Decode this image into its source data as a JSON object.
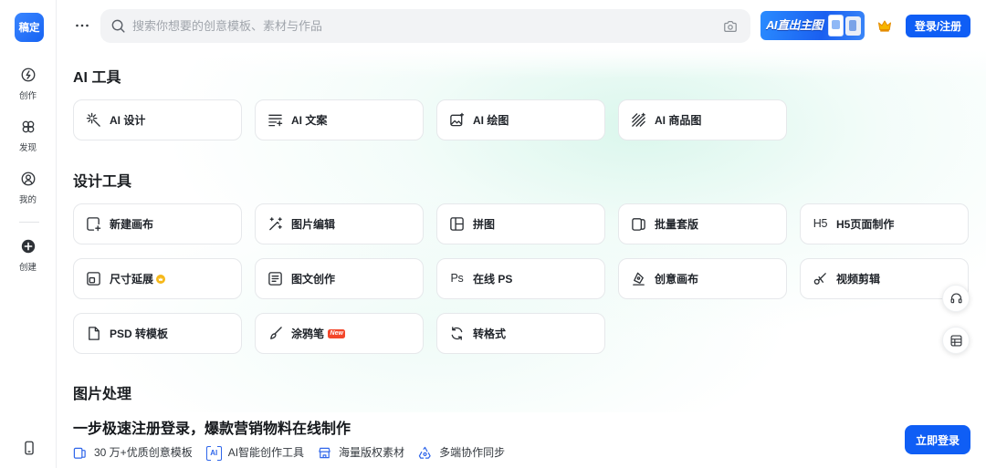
{
  "colors": {
    "primary": "#0f5ef5",
    "logo": "#1763f3",
    "new_badge": "#f3472b",
    "vip_badge": "#f6b81a",
    "feature_icon": "#2f66ea",
    "background_tint": "#e4f9f2"
  },
  "brand": {
    "logo_text": "稿定"
  },
  "sidebar": {
    "items": [
      {
        "label": "创作",
        "icon": "create-icon"
      },
      {
        "label": "发现",
        "icon": "discover-icon"
      },
      {
        "label": "我的",
        "icon": "profile-icon"
      },
      {
        "label": "创建",
        "icon": "add-circle-icon"
      }
    ],
    "bottom_icon": "mobile-icon"
  },
  "header": {
    "more_icon": "more-dots-icon",
    "search": {
      "placeholder": "搜索你想要的创意模板、素材与作品",
      "icon": "search-icon",
      "image_search_icon": "camera-icon"
    },
    "promo_banner": {
      "text": "AI直出主图"
    },
    "vip_icon": "crown-icon",
    "login_button": "登录/注册"
  },
  "sections": [
    {
      "title": "AI 工具",
      "items": [
        {
          "label": "AI 设计",
          "icon": "sparkle-icon"
        },
        {
          "label": "AI 文案",
          "icon": "text-lines-icon"
        },
        {
          "label": "AI 绘图",
          "icon": "image-icon"
        },
        {
          "label": "AI 商品图",
          "icon": "hatch-icon"
        }
      ]
    },
    {
      "title": "设计工具",
      "items": [
        {
          "label": "新建画布",
          "icon": "new-canvas-icon"
        },
        {
          "label": "图片编辑",
          "icon": "magic-wand-icon"
        },
        {
          "label": "拼图",
          "icon": "collage-icon"
        },
        {
          "label": "批量套版",
          "icon": "batch-icon"
        },
        {
          "label": "H5页面制作",
          "icon": "h5-icon",
          "icon_text": "H5"
        },
        {
          "label": "尺寸延展",
          "icon": "resize-icon",
          "badge_icon": "vip-badge-icon"
        },
        {
          "label": "图文创作",
          "icon": "doc-text-icon"
        },
        {
          "label": "在线 PS",
          "icon": "ps-icon",
          "icon_text": "Ps"
        },
        {
          "label": "创意画布",
          "icon": "pen-nib-icon"
        },
        {
          "label": "视频剪辑",
          "icon": "scissors-icon"
        },
        {
          "label": "PSD 转模板",
          "icon": "file-icon"
        },
        {
          "label": "涂鸦笔",
          "icon": "brush-icon",
          "badge": "New"
        },
        {
          "label": "转格式",
          "icon": "convert-icon"
        }
      ]
    },
    {
      "title": "图片处理"
    }
  ],
  "signup_bar": {
    "title": "一步极速注册登录，爆款营销物料在线制作",
    "features": [
      {
        "label": "30 万+优质创意模板",
        "icon": "template-icon"
      },
      {
        "label": "AI智能创作工具",
        "icon": "ai-icon",
        "icon_text": "AI"
      },
      {
        "label": "海量版权素材",
        "icon": "store-icon"
      },
      {
        "label": "多端协作同步",
        "icon": "sync-icon"
      }
    ],
    "login_button": "立即登录"
  },
  "floating_tools": [
    {
      "icon": "headset-icon"
    },
    {
      "icon": "table-icon"
    }
  ]
}
